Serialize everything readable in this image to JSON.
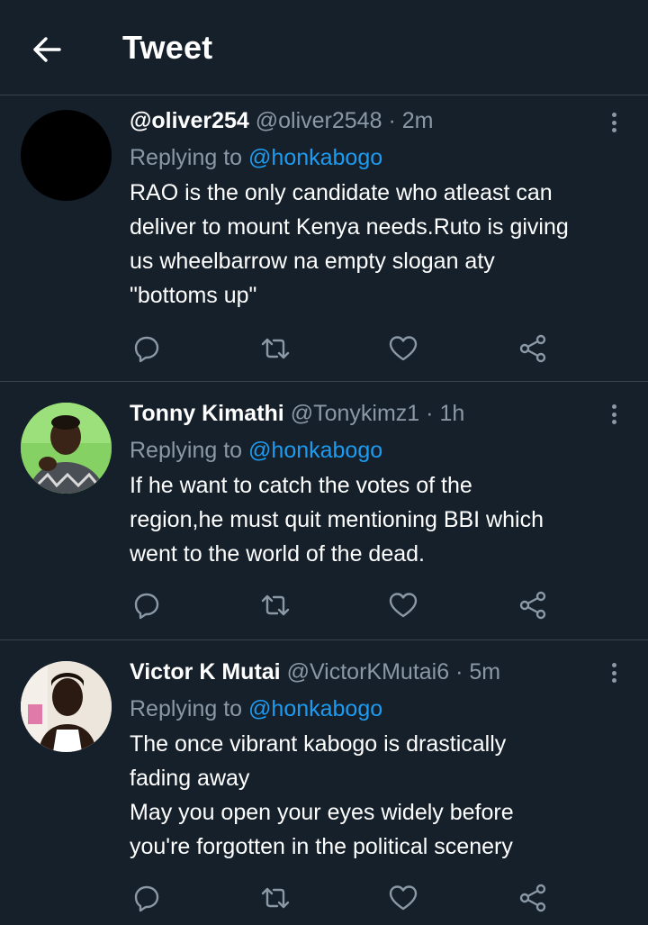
{
  "header": {
    "title": "Tweet",
    "back_icon": "arrow-left-icon"
  },
  "colors": {
    "background": "#15202b",
    "divider": "#38444d",
    "secondary_text": "#8b98a5",
    "link": "#1d9bf0",
    "icon": "#8b98a5"
  },
  "tweets": [
    {
      "name": "@oliver254",
      "handle": "@oliver2548",
      "separator": "·",
      "time": "2m",
      "replying_prefix": "Replying to",
      "replying_to": "@honkabogo",
      "lines": [
        "RAO is the only candidate who  atleast can",
        "deliver to mount Kenya needs.Ruto is giving",
        "us wheelbarrow na empty slogan aty",
        "\"bottoms up\""
      ]
    },
    {
      "name": "Tonny Kimathi",
      "handle": "@Tonykimz1",
      "separator": "·",
      "time": "1h",
      "replying_prefix": "Replying to",
      "replying_to": "@honkabogo",
      "lines": [
        "If he want to catch the votes of the",
        "region,he must quit mentioning BBI which",
        "went to the world of the dead."
      ]
    },
    {
      "name": "Victor K Mutai",
      "handle": "@VictorKMutai6",
      "separator": "·",
      "time": "5m",
      "replying_prefix": "Replying to",
      "replying_to": "@honkabogo",
      "lines": [
        "The once vibrant kabogo is drastically",
        "fading away",
        "May you open your eyes widely before",
        "you're forgotten in the political scenery"
      ]
    }
  ],
  "actions": [
    "reply-icon",
    "retweet-icon",
    "like-icon",
    "share-icon"
  ]
}
